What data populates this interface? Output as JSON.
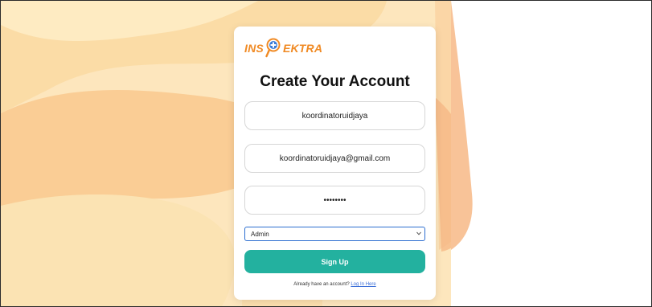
{
  "colors": {
    "logo_accent": "#f08a24",
    "button": "#23b19f",
    "select_border": "#2d6fd0",
    "link": "#3b6fd8"
  },
  "logo": {
    "left_text": "INS",
    "right_text": "EKTRA",
    "icon": "magnifier-plus-icon"
  },
  "form": {
    "title": "Create Your Account",
    "username_value": "koordinatoruidjaya",
    "email_value": "koordinatoruidjaya@gmail.com",
    "password_value": "••••••••",
    "role_selected": "Admin",
    "signup_label": "Sign Up",
    "footer_text": "Already have an account?",
    "login_link": "Log In Here"
  }
}
